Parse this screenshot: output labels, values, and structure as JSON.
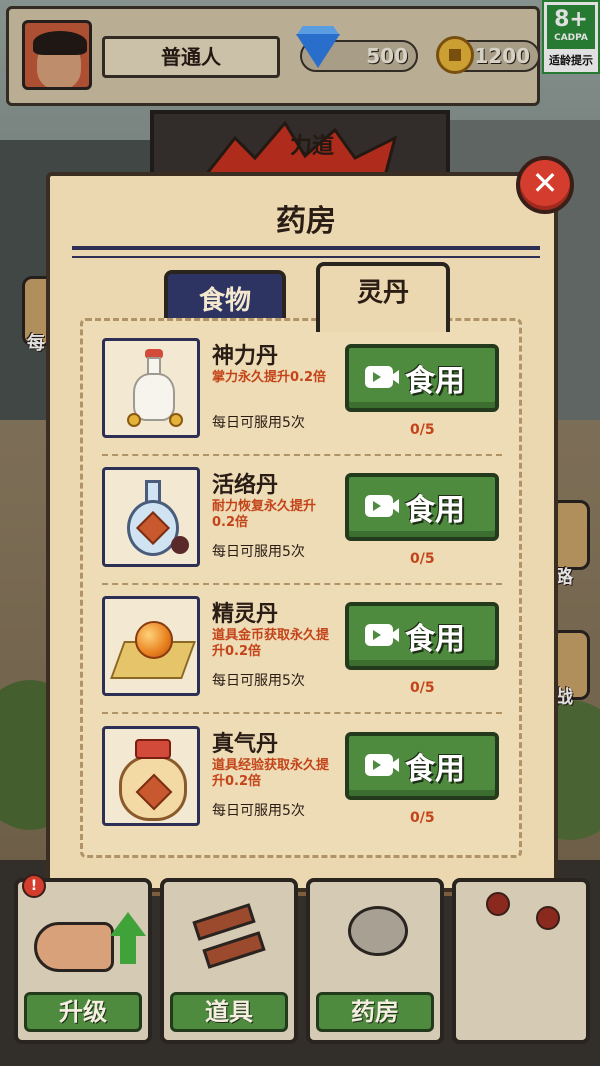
{
  "hud": {
    "player_title": "普通人",
    "gems": "500",
    "gold": "1200"
  },
  "age_badge": {
    "rating": "8+",
    "org": "CADPA",
    "note": "适龄提示"
  },
  "background": {
    "power_label": "力道",
    "side_left_label": "每日",
    "side_right_labels": [
      "路",
      "战"
    ]
  },
  "modal": {
    "title": "药房",
    "tabs": [
      {
        "label": "食物",
        "active": false
      },
      {
        "label": "灵丹",
        "active": true
      }
    ],
    "use_label": "食用",
    "items": [
      {
        "name": "神力丹",
        "desc": "掌力永久提升0.2倍",
        "limit": "每日可服用5次",
        "count": "0/5",
        "icon": "white-vase-icon"
      },
      {
        "name": "活络丹",
        "desc": "耐力恢复永久提升0.2倍",
        "limit": "每日可服用5次",
        "count": "0/5",
        "icon": "potion-flask-icon"
      },
      {
        "name": "精灵丹",
        "desc": "道具金币获取永久提升0.2倍",
        "limit": "每日可服用5次",
        "count": "0/5",
        "icon": "golden-orb-icon"
      },
      {
        "name": "真气丹",
        "desc": "道具经验获取永久提升0.2倍",
        "limit": "每日可服用5次",
        "count": "0/5",
        "icon": "elixir-jar-icon"
      }
    ]
  },
  "bottom_nav": [
    {
      "label": "升级",
      "icon": "hand-upgrade-icon"
    },
    {
      "label": "道具",
      "icon": "bricks-icon"
    },
    {
      "label": "药房",
      "icon": "teapot-icon"
    }
  ],
  "colors": {
    "panel": "#ecd8b0",
    "tab_active_dark": "#2e3462",
    "use_button": "#4f8b3e",
    "desc_red": "#c4441a",
    "close_red": "#d43d2d"
  }
}
